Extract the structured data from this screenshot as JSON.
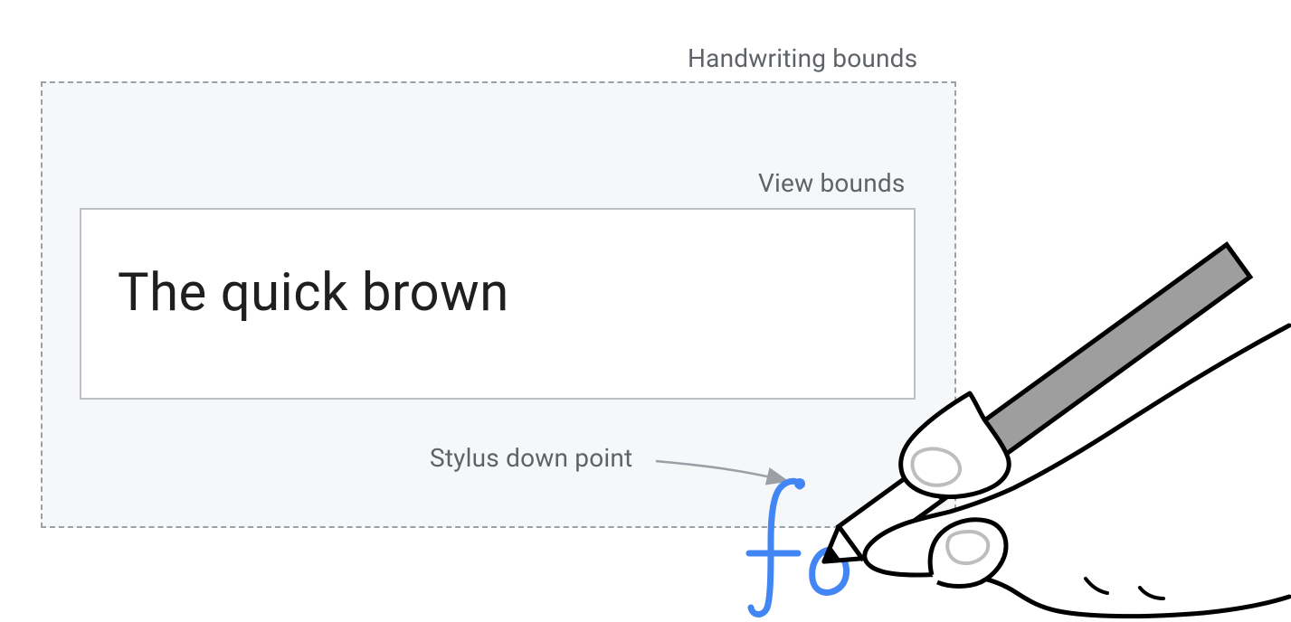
{
  "labels": {
    "handwriting_bounds": "Handwriting bounds",
    "view_bounds": "View bounds",
    "stylus_down_point": "Stylus down point"
  },
  "text": {
    "field_value": "The quick brown",
    "handwriting_stroke": "fo"
  },
  "colors": {
    "label": "#5f6368",
    "stroke_ink": "#4285f4",
    "border_dashed": "#9aa0a6",
    "border_solid": "#bdc1c6",
    "bg_handwriting": "#f6f7f8",
    "stylus_fill": "#9e9e9e"
  }
}
